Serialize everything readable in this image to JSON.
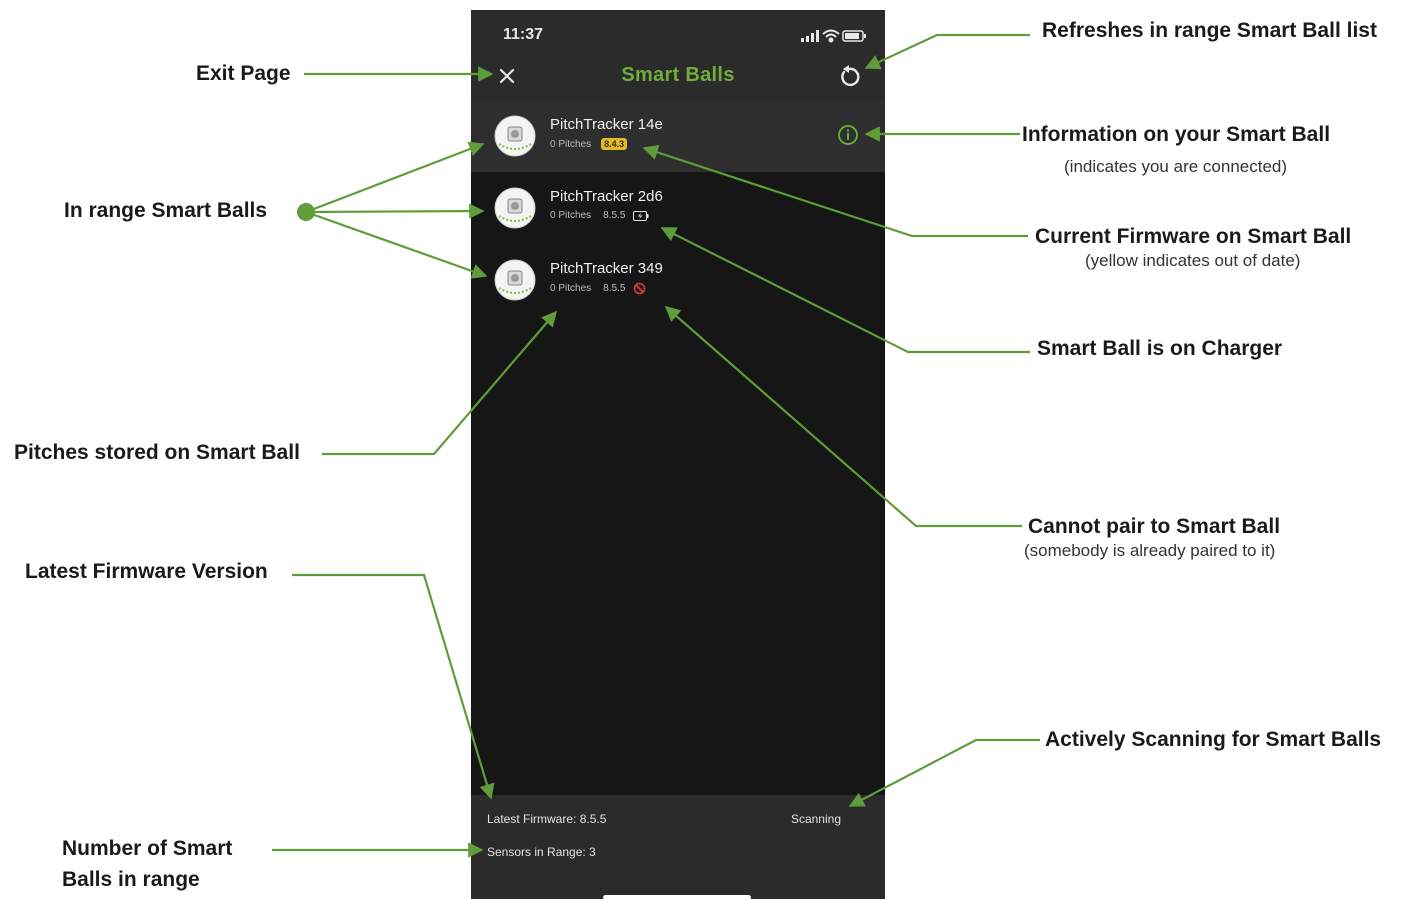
{
  "phone": {
    "status_time": "11:37",
    "title": "Smart Balls",
    "balls": [
      {
        "name": "PitchTracker 14e",
        "pitches": "0 Pitches",
        "firmware": "8.4.3",
        "firmware_status": "out-of-date",
        "connected": true
      },
      {
        "name": "PitchTracker 2d6",
        "pitches": "0 Pitches",
        "firmware": "8.5.5",
        "status_icon": "battery-charging-icon"
      },
      {
        "name": "PitchTracker 349",
        "pitches": "0 Pitches",
        "firmware": "8.5.5",
        "status_icon": "blocked-icon"
      }
    ],
    "footer": {
      "latest_firmware": "Latest Firmware: 8.5.5",
      "scanning": "Scanning",
      "sensors_in_range": "Sensors in Range: 3"
    }
  },
  "annotations": {
    "exit_page": "Exit Page",
    "in_range": "In range Smart Balls",
    "pitches_stored": "Pitches stored on Smart Ball",
    "latest_firmware": "Latest Firmware Version",
    "number_in_range_1": "Number of Smart",
    "number_in_range_2": "Balls in range",
    "refreshes": "Refreshes in range Smart Ball list",
    "information": "Information on your Smart Ball",
    "information_sub": "(indicates you are connected)",
    "current_firmware": "Current Firmware on Smart Ball",
    "current_firmware_sub": "(yellow indicates out of date)",
    "on_charger": "Smart Ball is on Charger",
    "cannot_pair": "Cannot pair to Smart Ball",
    "cannot_pair_sub": "(somebody is already paired to it)",
    "scanning": "Actively Scanning for Smart Balls"
  },
  "colors": {
    "accent_green": "#6fae3d",
    "arrow_green": "#5e9d3a",
    "firmware_yellow": "#e3b92a",
    "blocked_red": "#e53935",
    "phone_bg": "#161616",
    "bar_bg": "#2b2b2b"
  }
}
